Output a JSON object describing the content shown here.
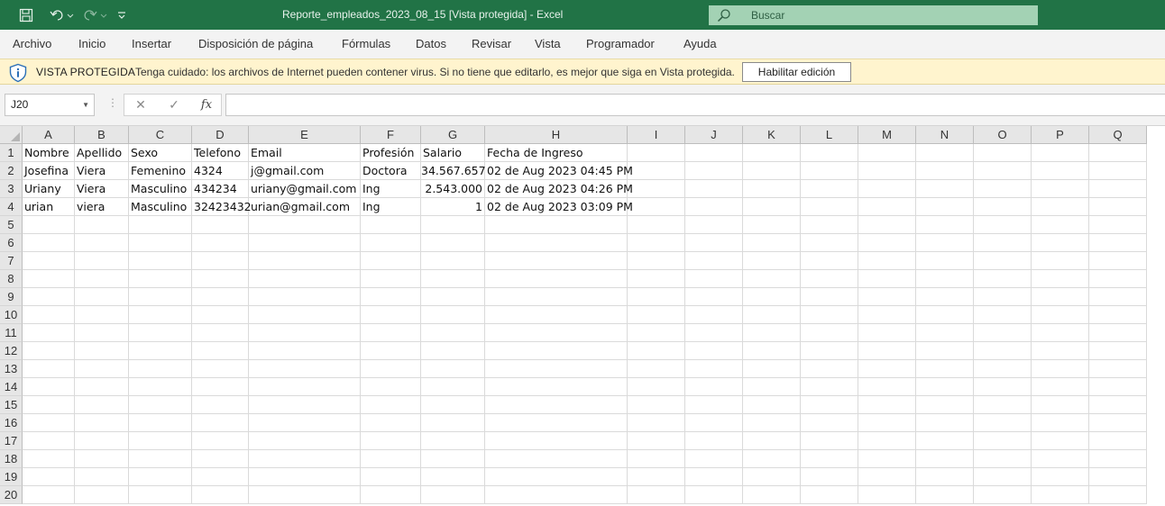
{
  "titlebar": {
    "title": "Reporte_empleados_2023_08_15  [Vista protegida]  -  Excel",
    "search_placeholder": "Buscar",
    "quick_access": [
      "save-icon",
      "undo-icon",
      "redo-icon",
      "customize-icon"
    ]
  },
  "ribbon": {
    "tabs": [
      "Archivo",
      "Inicio",
      "Insertar",
      "Disposición de página",
      "Fórmulas",
      "Datos",
      "Revisar",
      "Vista",
      "Programador",
      "Ayuda"
    ]
  },
  "protected_view": {
    "title": "VISTA PROTEGIDA",
    "message": "Tenga cuidado: los archivos de Internet pueden contener virus. Si no tiene que editarlo, es mejor que siga en Vista protegida.",
    "button": "Habilitar edición"
  },
  "formula_bar": {
    "name_box": "J20",
    "formula": "",
    "fx_label": "fx"
  },
  "grid": {
    "columns": [
      "A",
      "B",
      "C",
      "D",
      "E",
      "F",
      "G",
      "H",
      "I",
      "J",
      "K",
      "L",
      "M",
      "N",
      "O",
      "P",
      "Q"
    ],
    "row_numbers": [
      "1",
      "2",
      "3",
      "4",
      "5",
      "6",
      "7",
      "8",
      "9",
      "10",
      "11",
      "12",
      "13",
      "14",
      "15",
      "16",
      "17",
      "18",
      "19",
      "20"
    ],
    "rows": [
      [
        "Nombre",
        "Apellido",
        "Sexo",
        "Telefono",
        "Email",
        "Profesión",
        "Salario",
        "Fecha de Ingreso"
      ],
      [
        "Josefina",
        "Viera",
        "Femenino",
        "4324",
        "j@gmail.com",
        "Doctora",
        "34.567.657",
        "02 de Aug 2023 04:45 PM"
      ],
      [
        "Uriany",
        "Viera",
        "Masculino",
        "434234",
        "uriany@gmail.com",
        "Ing",
        "2.543.000",
        "02 de Aug 2023 04:26 PM"
      ],
      [
        "urian",
        "viera",
        "Masculino",
        "32423432",
        "urian@gmail.com",
        "Ing",
        "1",
        "02 de Aug 2023 03:09 PM"
      ]
    ],
    "numeric_columns": [
      6
    ]
  }
}
